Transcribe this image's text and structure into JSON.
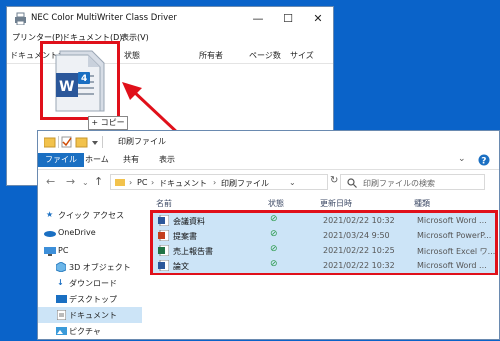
{
  "printer_window": {
    "title": "NEC Color MultiWriter Class Driver",
    "controls": {
      "minimize": "—",
      "maximize": "☐",
      "close": "✕"
    },
    "menu": [
      "プリンター(P)",
      "ドキュメント(D)",
      "表示(V)"
    ],
    "columns": [
      "ドキュメント名",
      "状態",
      "所有者",
      "ページ数",
      "サイズ"
    ]
  },
  "drag": {
    "badge": "4",
    "copy_label": "+ コピー"
  },
  "explorer": {
    "title": "印刷ファイル",
    "ribbon_tabs": [
      "ファイル",
      "ホーム",
      "共有",
      "表示"
    ],
    "address": [
      "PC",
      "ドキュメント",
      "印刷ファイル"
    ],
    "search_placeholder": "印刷ファイルの検索",
    "sidebar": [
      {
        "label": "クイック アクセス",
        "icon": "star-icon"
      },
      {
        "label": "OneDrive",
        "icon": "cloud-icon"
      },
      {
        "label": "PC",
        "icon": "pc-icon"
      },
      {
        "label": "3D オブジェクト",
        "icon": "cube-icon"
      },
      {
        "label": "ダウンロード",
        "icon": "download-icon"
      },
      {
        "label": "デスクトップ",
        "icon": "desktop-icon"
      },
      {
        "label": "ドキュメント",
        "icon": "documents-icon"
      },
      {
        "label": "ピクチャ",
        "icon": "pictures-icon"
      }
    ],
    "columns": {
      "name": "名前",
      "status": "状態",
      "modified": "更新日時",
      "type": "種類"
    },
    "files": [
      {
        "name": "会議資料",
        "date": "2021/02/22 10:32",
        "type": "Microsoft Word ...",
        "app": "word",
        "color": "#2b579a"
      },
      {
        "name": "提案書",
        "date": "2021/03/24 9:50",
        "type": "Microsoft PowerP...",
        "app": "powerpoint",
        "color": "#c43e1c"
      },
      {
        "name": "売上報告書",
        "date": "2021/02/22 10:25",
        "type": "Microsoft Excel ワ...",
        "app": "excel",
        "color": "#217346"
      },
      {
        "name": "論文",
        "date": "2021/02/22 10:32",
        "type": "Microsoft Word ...",
        "app": "word",
        "color": "#2b579a"
      }
    ]
  },
  "colors": {
    "highlight": "#e0101a",
    "accent": "#1a6fc2",
    "desktop": "#0a63c9"
  }
}
